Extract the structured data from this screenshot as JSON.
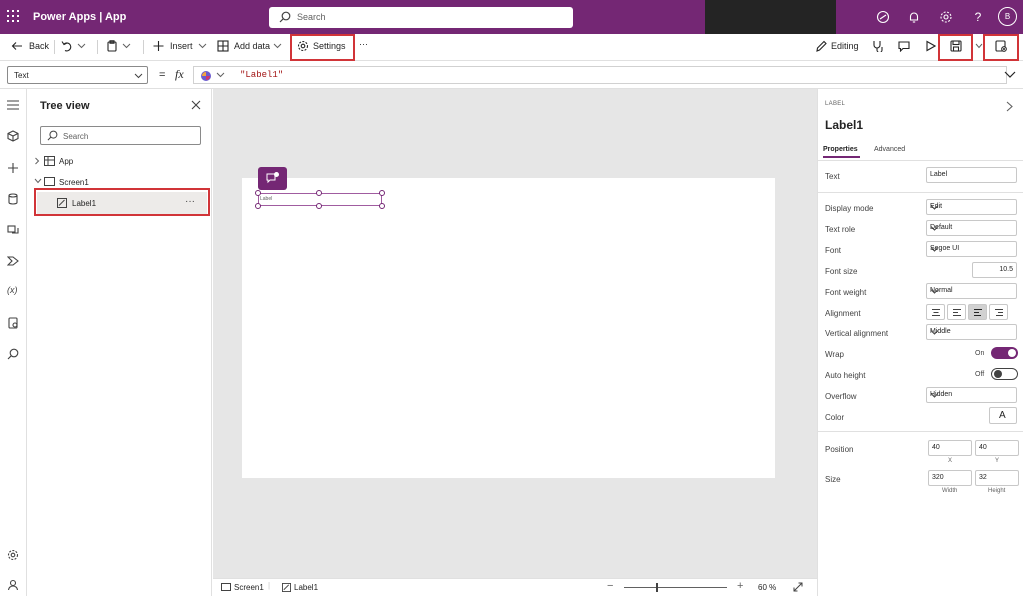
{
  "header": {
    "brand": "Power Apps  |  App",
    "search_placeholder": "Search",
    "avatar_initial": "B"
  },
  "toolbar": {
    "back": "Back",
    "insert": "Insert",
    "add_data": "Add data",
    "settings": "Settings",
    "more": "···",
    "editing": "Editing"
  },
  "formula": {
    "property": "Text",
    "fx": "fx",
    "equals": "=",
    "value": "\"Label1\""
  },
  "tree": {
    "title": "Tree view",
    "search_placeholder": "Search",
    "app": "App",
    "screen": "Screen1",
    "label": "Label1",
    "more": "···"
  },
  "canvas": {
    "label_text": "Label"
  },
  "status": {
    "screen_tab": "Screen1",
    "label_tab": "Label1",
    "zoom": "60  %"
  },
  "props": {
    "kind": "LABEL",
    "name": "Label1",
    "tabs": [
      "Properties",
      "Advanced"
    ],
    "text_label": "Text",
    "text_value": "Label",
    "display_mode_label": "Display mode",
    "display_mode_value": "Edit",
    "text_role_label": "Text role",
    "text_role_value": "Default",
    "font_label": "Font",
    "font_value": "Segoe UI",
    "font_size_label": "Font size",
    "font_size_value": "10.5",
    "font_weight_label": "Font weight",
    "font_weight_value": "Normal",
    "alignment_label": "Alignment",
    "valign_label": "Vertical alignment",
    "valign_value": "Middle",
    "wrap_label": "Wrap",
    "wrap_value": "On",
    "autoheight_label": "Auto height",
    "autoheight_value": "Off",
    "overflow_label": "Overflow",
    "overflow_value": "Hidden",
    "color_label": "Color",
    "color_value": "A",
    "position_label": "Position",
    "pos_x": "40",
    "pos_y": "40",
    "x_label": "X",
    "y_label": "Y",
    "size_label": "Size",
    "width": "320",
    "height": "32",
    "width_label": "Width",
    "height_label": "Height"
  },
  "colors": {
    "brand": "#742774",
    "highlight": "#d13438"
  }
}
